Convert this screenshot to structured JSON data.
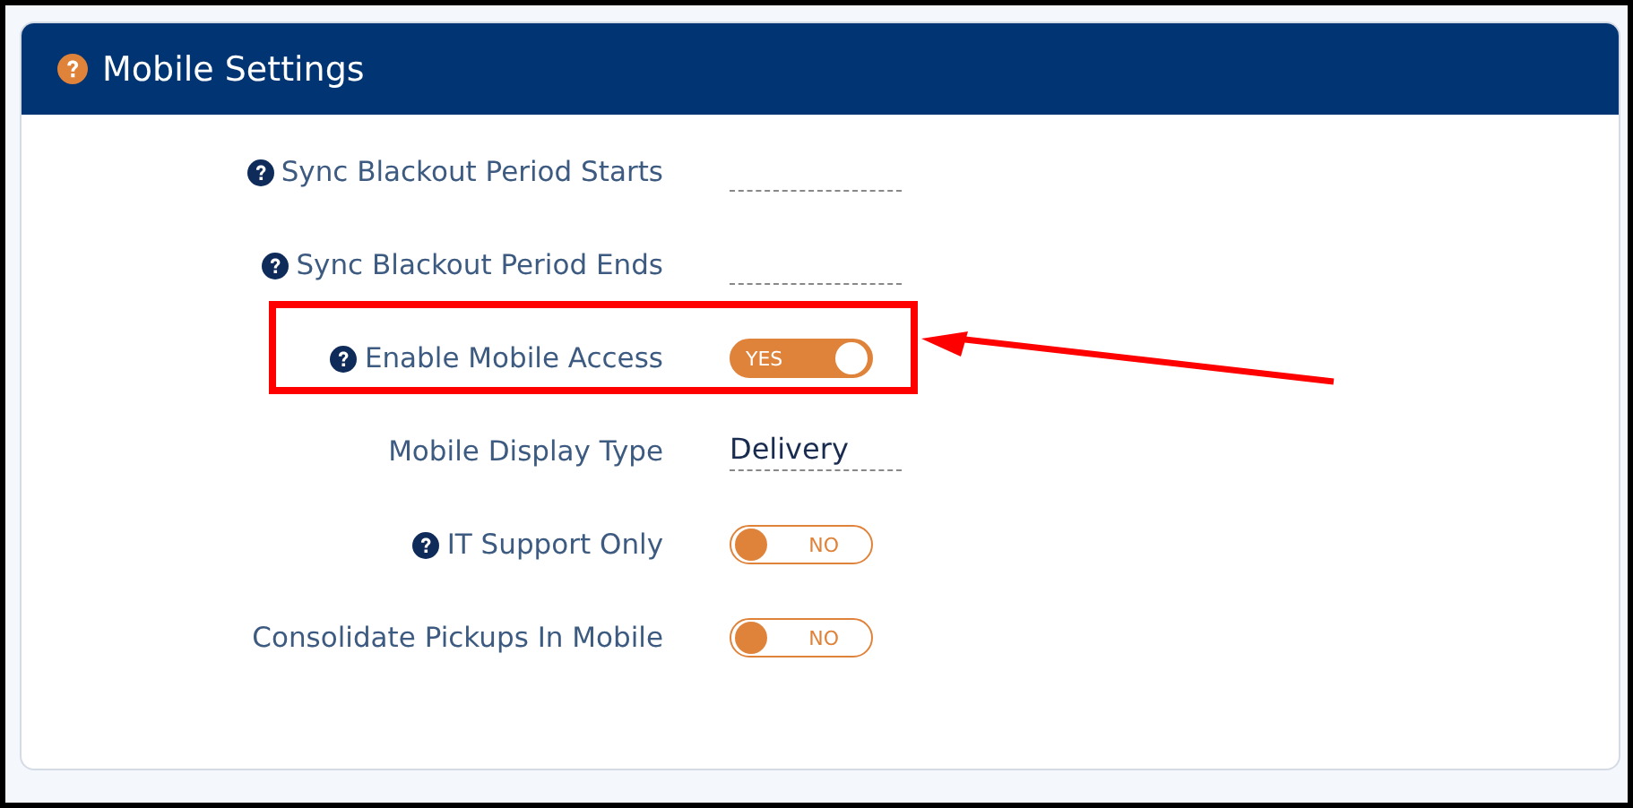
{
  "panel": {
    "title": "Mobile Settings",
    "help": true
  },
  "fields": [
    {
      "kind": "text",
      "label": "Sync Blackout Period Starts",
      "help": true,
      "highlighted": false
    },
    {
      "kind": "text",
      "label": "Sync Blackout Period Ends",
      "help": true,
      "highlighted": false
    },
    {
      "kind": "toggle",
      "label": "Enable Mobile Access",
      "help": true,
      "highlighted": true,
      "on": true,
      "state_label": "YES"
    },
    {
      "kind": "select",
      "label": "Mobile Display Type",
      "help": false,
      "highlighted": false,
      "value": "Delivery"
    },
    {
      "kind": "toggle",
      "label": "IT Support Only",
      "help": true,
      "highlighted": false,
      "on": false,
      "state_label": "NO"
    },
    {
      "kind": "toggle",
      "label": "Consolidate Pickups In Mobile",
      "help": false,
      "highlighted": false,
      "on": false,
      "state_label": "NO"
    }
  ]
}
